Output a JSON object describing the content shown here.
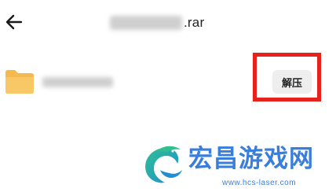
{
  "header": {
    "back_icon": "arrow-left-icon",
    "title_extension": ".rar"
  },
  "file_row": {
    "folder_icon": "folder-icon",
    "folder_color": "#F6B94E",
    "extract_label": "解压"
  },
  "highlight_color": "#E5231C",
  "watermark": {
    "title": "宏昌游戏网",
    "url": "www.hcs-laser.com",
    "color": "#3A7EDB"
  }
}
